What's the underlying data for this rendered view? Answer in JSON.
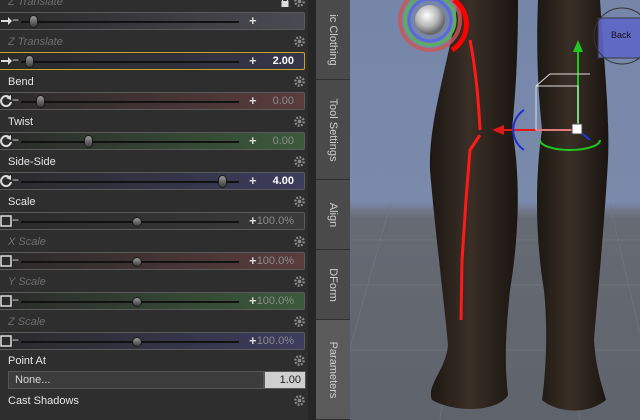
{
  "parameters": [
    {
      "label": "Z Translate",
      "value": "",
      "dim": true,
      "color": "#4a4a52",
      "knob_fraction": 0.04,
      "icon": "translate-arrow-icon",
      "lock": true
    },
    {
      "label": "Z Translate",
      "value": "2.00",
      "dim": true,
      "color": "#35354a",
      "knob_fraction": 0.02,
      "icon": "translate-arrow-icon",
      "selected": true
    },
    {
      "label": "Bend",
      "value": "0.00",
      "dim": false,
      "color": "#5a3c3c",
      "knob_fraction": 0.07,
      "icon": "rotate-icon"
    },
    {
      "label": "Twist",
      "value": "0.00",
      "dim": false,
      "color": "#3c5a3c",
      "knob_fraction": 0.3,
      "icon": "rotate-icon"
    },
    {
      "label": "Side-Side",
      "value": "4.00",
      "dim": false,
      "color": "#3c3c5e",
      "knob_fraction": 0.94,
      "icon": "rotate-icon"
    },
    {
      "label": "Scale",
      "value": "100.0%",
      "dim": false,
      "color": "#3a3a3a",
      "knob_fraction": 0.53,
      "icon": "scale-box-icon"
    },
    {
      "label": "X Scale",
      "value": "100.0%",
      "dim": true,
      "color": "#5a3c3c",
      "knob_fraction": 0.53,
      "icon": "scale-box-icon"
    },
    {
      "label": "Y Scale",
      "value": "100.0%",
      "dim": true,
      "color": "#3c5a3c",
      "knob_fraction": 0.53,
      "icon": "scale-box-icon"
    },
    {
      "label": "Z Scale",
      "value": "100.0%",
      "dim": true,
      "color": "#3c3c5e",
      "knob_fraction": 0.53,
      "icon": "scale-box-icon"
    }
  ],
  "point_at": {
    "label": "Point At",
    "value": "None...",
    "number": "1.00"
  },
  "cast_shadows": {
    "label": "Cast Shadows"
  },
  "tabs": [
    {
      "label": "ic Clothing",
      "active": false
    },
    {
      "label": "Tool Settings",
      "active": false
    },
    {
      "label": "Align",
      "active": false
    },
    {
      "label": "DForm",
      "active": false
    },
    {
      "label": "Parameters",
      "active": true
    }
  ],
  "viewport": {
    "corner_label": "Back"
  }
}
